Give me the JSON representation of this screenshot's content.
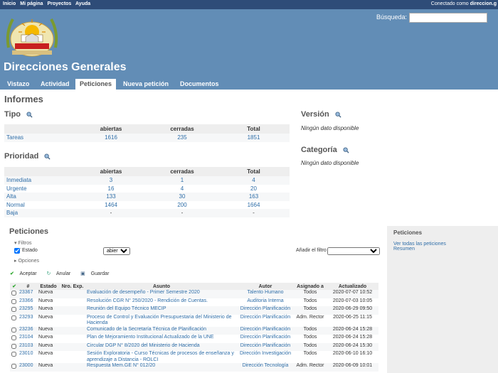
{
  "top_menu": {
    "items": [
      "Inicio",
      "Mi página",
      "Proyectos",
      "Ayuda"
    ],
    "logged_as_prefix": "Conectado como",
    "logged_as_user": "direccion.g"
  },
  "header": {
    "search_label": "Búsqueda:",
    "project_title": "Direcciones Generales",
    "logo_text": "UTEPSA"
  },
  "tabs": [
    "Vistazo",
    "Actividad",
    "Peticiones",
    "Nueva petición",
    "Documentos"
  ],
  "page_title": "Informes",
  "tipo": {
    "title": "Tipo",
    "headers": [
      "",
      "abiertas",
      "cerradas",
      "Total"
    ],
    "rows": [
      [
        "Tareas",
        "1616",
        "235",
        "1851"
      ]
    ]
  },
  "prioridad": {
    "title": "Prioridad",
    "headers": [
      "",
      "abiertas",
      "cerradas",
      "Total"
    ],
    "rows": [
      [
        "Inmediata",
        "3",
        "1",
        "4"
      ],
      [
        "Urgente",
        "16",
        "4",
        "20"
      ],
      [
        "Alta",
        "133",
        "30",
        "163"
      ],
      [
        "Normal",
        "1464",
        "200",
        "1664"
      ],
      [
        "Baja",
        "-",
        "-",
        "-"
      ]
    ]
  },
  "version": {
    "title": "Versión",
    "nodata": "Ningún dato disponible"
  },
  "categoria": {
    "title": "Categoría",
    "nodata": "Ningún dato disponible"
  },
  "peticiones": {
    "title": "Peticiones",
    "filtros_label": "Filtros",
    "estado_label": "Estado",
    "estado_value": "abierta",
    "add_filter_label": "Añadir el filtro",
    "opciones_label": "Opciones",
    "aceptar": "Aceptar",
    "anular": "Anular",
    "guardar": "Guardar",
    "columns": [
      "",
      "#",
      "Estado",
      "Nro. Exp.",
      "Asunto",
      "Autor",
      "Asignado a",
      "Actualizado"
    ],
    "rows": [
      {
        "id": "23367",
        "estado": "Nueva",
        "exp": "",
        "asunto": "Evaluación de desempeño - Primer Semestre 2020",
        "autor": "Talento Humano",
        "asignado": "Todos",
        "fecha": "2020-07-07 10:52"
      },
      {
        "id": "23366",
        "estado": "Nueva",
        "exp": "",
        "asunto": "Resolución CGR N° 250/2020 - Rendición de Cuentas.",
        "autor": "Auditoria Interna",
        "asignado": "Todos",
        "fecha": "2020-07-03 10:05"
      },
      {
        "id": "23295",
        "estado": "Nueva",
        "exp": "",
        "asunto": "Reunión del Equipo Técnico MECIP",
        "autor": "Dirección Planificación",
        "asignado": "Todos",
        "fecha": "2020-06-29 09:50"
      },
      {
        "id": "23293",
        "estado": "Nueva",
        "exp": "",
        "asunto": "Proceso de Control y Evaluación Presupuestaria del Ministerio de Hacienda",
        "autor": "Dirección Planificación",
        "asignado": "Adm. Rector",
        "fecha": "2020-06-25 11:15"
      },
      {
        "id": "23236",
        "estado": "Nueva",
        "exp": "",
        "asunto": "Comunicado de la Secretaría Técnica de Planificación",
        "autor": "Dirección Planificación",
        "asignado": "Todos",
        "fecha": "2020-06-24 15:28"
      },
      {
        "id": "23104",
        "estado": "Nueva",
        "exp": "",
        "asunto": "Plan de Mejoramiento Institucional Actualizado de la UNE",
        "autor": "Dirección Planificación",
        "asignado": "Todos",
        "fecha": "2020-06-24 15:28"
      },
      {
        "id": "23103",
        "estado": "Nueva",
        "exp": "",
        "asunto": "Circular DGP N° 8/2020 del Ministerio de Hacienda",
        "autor": "Dirección Planificación",
        "asignado": "Todos",
        "fecha": "2020-06-24 15:30"
      },
      {
        "id": "23010",
        "estado": "Nueva",
        "exp": "",
        "asunto": "Sesión Exploratoria - Curso Técnicas de procesos de enseñanza y aprendizaje a Distancia - ROLCI",
        "autor": "Dirección Investigación",
        "asignado": "Todos",
        "fecha": "2020-06-10 16:10"
      },
      {
        "id": "23000",
        "estado": "Nueva",
        "exp": "",
        "asunto": "Respuesta Mem.GE N° 012/20",
        "autor": "Dirección Tecnología",
        "asignado": "Adm. Rector",
        "fecha": "2020-06-09 10:01"
      }
    ]
  },
  "sidebar": {
    "title": "Peticiones",
    "links": [
      "Ver todas las peticiones",
      "Resumen"
    ]
  },
  "colors": {
    "header": "#628db6",
    "top_menu": "#2e4c78",
    "link": "#2f6ea8"
  }
}
